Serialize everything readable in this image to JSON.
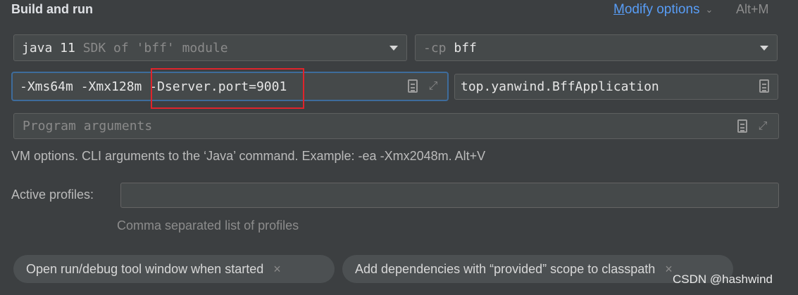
{
  "header": {
    "title": "Build and run",
    "modify_options_mnemonic": "M",
    "modify_options_rest": "odify options",
    "modify_options_chevron": "⌄",
    "shortcut": "Alt+M"
  },
  "sdk_combo": {
    "value_bright": "java 11",
    "value_dim": " SDK of 'bff' module"
  },
  "cp_combo": {
    "prefix": "-cp",
    "value": " bff"
  },
  "vm_options": {
    "value": "-Xms64m -Xmx128m -Dserver.port=9001"
  },
  "main_class": {
    "value": "top.yanwind.BffApplication"
  },
  "program_arguments": {
    "placeholder": "Program arguments"
  },
  "vm_description": "VM options. CLI arguments to the ‘Java’ command. Example: -ea -Xmx2048m. Alt+V",
  "active_profiles": {
    "label": "Active profiles:",
    "value": "",
    "hint": "Comma separated list of profiles"
  },
  "chips": [
    {
      "label": "Open run/debug tool window when started",
      "close": "×"
    },
    {
      "label": "Add dependencies with “provided” scope to classpath",
      "close": "×"
    }
  ],
  "watermark": "CSDN @hashwind",
  "colors": {
    "accent_link": "#589df6",
    "focus_border": "#3e6c9c",
    "highlight_box": "#e0242b",
    "background": "#3c3f41"
  }
}
